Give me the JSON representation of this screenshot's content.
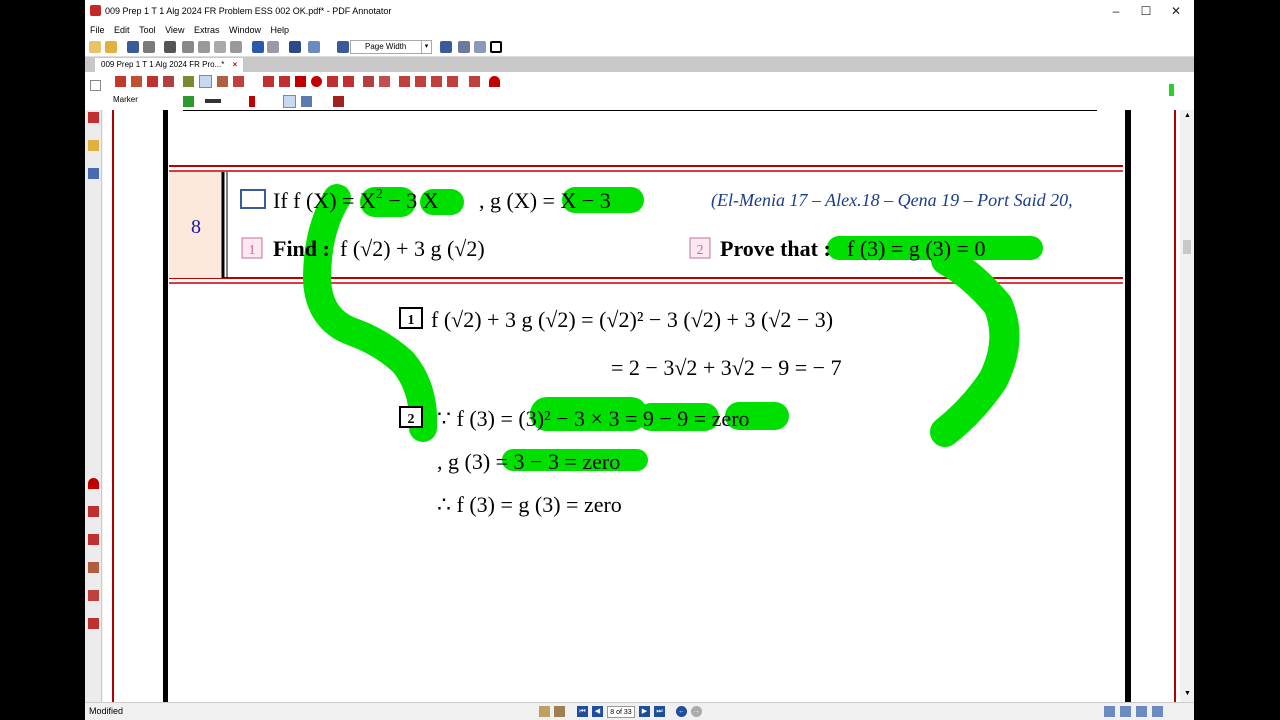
{
  "window": {
    "title": "009  Prep 1  T 1  Alg  2024  FR  Problem  ESS  002  OK.pdf* - PDF Annotator",
    "minimize": "–",
    "maximize": "☐",
    "close": "✕"
  },
  "menu": [
    "File",
    "Edit",
    "Tool",
    "View",
    "Extras",
    "Window",
    "Help"
  ],
  "toolbar": {
    "zoom_value": "Page Width"
  },
  "tab": {
    "label": "009  Prep 1  T 1  Alg  2024  FR  Pro...*",
    "close": "×"
  },
  "annotation_toolbar": {
    "current_tool": "Marker"
  },
  "document": {
    "problem_number": "8",
    "line1_lhs": "If f (X) = X",
    "line1_exp": "2",
    "line1_rest": " − 3 X",
    "line1_g": ",  g (X) = X − 3",
    "sources": "(El-Menia 17 – Alex.18 – Qena 19 – Port Said 20,",
    "part1_num": "1",
    "part1_label": "Find :",
    "part1_expr": "f (√2) + 3 g (√2)",
    "part2_num": "2",
    "part2_label": "Prove that :",
    "part2_expr": "f (3) = g (3) = 0",
    "sol1_num": "1",
    "sol1_line1": "f (√2) + 3 g (√2) = (√2)² − 3 (√2) + 3 (√2 − 3)",
    "sol1_line2": "= 2 − 3√2 + 3√2 − 9 = − 7",
    "sol2_num": "2",
    "sol2_line1": "∵ f (3) = (3)² − 3 × 3 = 9 − 9 = zero",
    "sol2_line2": ", g (3) = 3 − 3 = zero",
    "sol2_line3": "∴ f (3) = g (3) = zero"
  },
  "status": {
    "text": "Modified",
    "page_indicator": "8 of 33"
  },
  "colors": {
    "highlight": "#00e000",
    "problem_number": "#1a1aa0",
    "sources": "#1a3c8c",
    "border_red": "#b00000"
  }
}
